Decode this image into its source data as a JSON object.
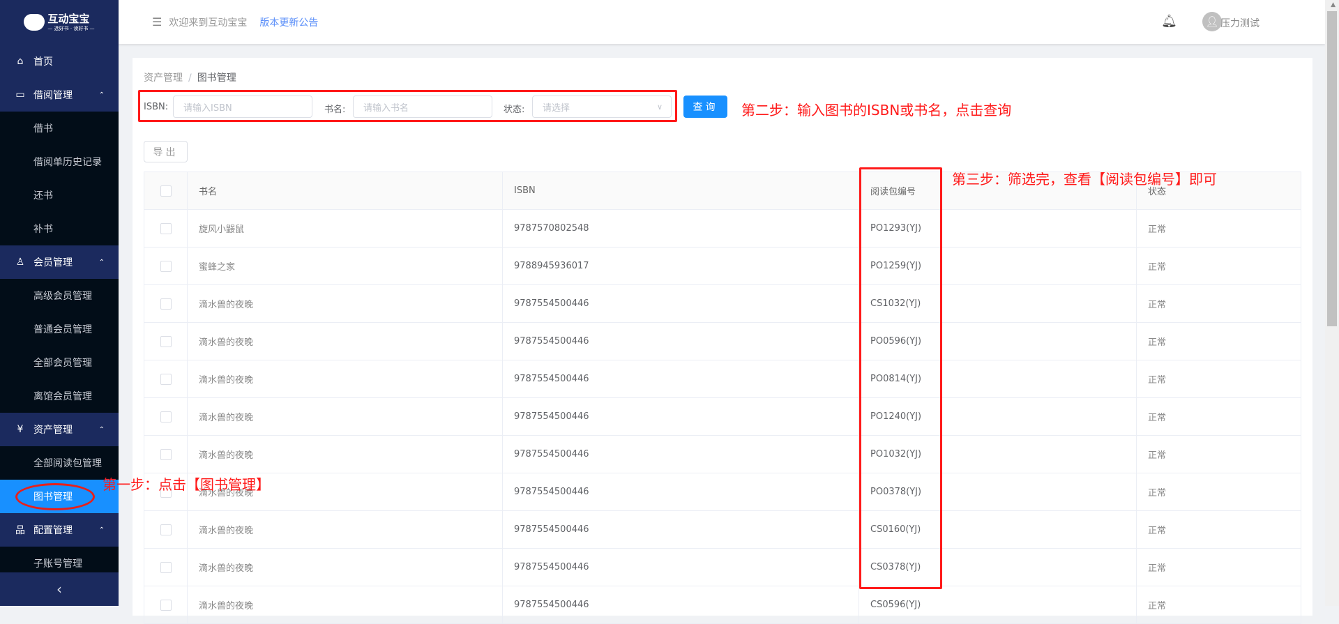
{
  "sidebar": {
    "logo": {
      "title": "互动宝宝",
      "subtitle": "— 选好书 · 读好书 —"
    },
    "items": [
      {
        "label": "首页",
        "type": "top",
        "icon": "home-icon"
      },
      {
        "label": "借阅管理",
        "type": "top",
        "icon": "book-icon",
        "expanded": true
      },
      {
        "label": "借书",
        "type": "sub"
      },
      {
        "label": "借阅单历史记录",
        "type": "sub"
      },
      {
        "label": "还书",
        "type": "sub"
      },
      {
        "label": "补书",
        "type": "sub"
      },
      {
        "label": "会员管理",
        "type": "top",
        "icon": "members-icon",
        "expanded": true
      },
      {
        "label": "高级会员管理",
        "type": "sub"
      },
      {
        "label": "普通会员管理",
        "type": "sub"
      },
      {
        "label": "全部会员管理",
        "type": "sub"
      },
      {
        "label": "离馆会员管理",
        "type": "sub"
      },
      {
        "label": "资产管理",
        "type": "top",
        "icon": "asset-icon",
        "expanded": true
      },
      {
        "label": "全部阅读包管理",
        "type": "sub"
      },
      {
        "label": "图书管理",
        "type": "sub",
        "active": true
      },
      {
        "label": "配置管理",
        "type": "top",
        "icon": "sitemap-icon",
        "expanded": true
      },
      {
        "label": "子账号管理",
        "type": "sub"
      }
    ],
    "collapse_icon": "‹"
  },
  "header": {
    "welcome": "欢迎来到互动宝宝",
    "notice_link": "版本更新公告",
    "username": "压力测试"
  },
  "breadcrumb": {
    "parent": "资产管理",
    "current": "图书管理"
  },
  "filters": {
    "isbn_label": "ISBN:",
    "isbn_placeholder": "请输入ISBN",
    "name_label": "书名:",
    "name_placeholder": "请输入书名",
    "status_label": "状态:",
    "status_placeholder": "请选择",
    "query_button": "查询"
  },
  "export_button": "导出",
  "table": {
    "columns": [
      "书名",
      "ISBN",
      "阅读包编号",
      "状态"
    ],
    "rows": [
      [
        "旋风小鼹鼠",
        "9787570802548",
        "PO1293(YJ)",
        "正常"
      ],
      [
        "蜜蜂之家",
        "9788945936017",
        "PO1259(YJ)",
        "正常"
      ],
      [
        "滴水兽的夜晚",
        "9787554500446",
        "CS1032(YJ)",
        "正常"
      ],
      [
        "滴水兽的夜晚",
        "9787554500446",
        "PO0596(YJ)",
        "正常"
      ],
      [
        "滴水兽的夜晚",
        "9787554500446",
        "PO0814(YJ)",
        "正常"
      ],
      [
        "滴水兽的夜晚",
        "9787554500446",
        "PO1240(YJ)",
        "正常"
      ],
      [
        "滴水兽的夜晚",
        "9787554500446",
        "PO1032(YJ)",
        "正常"
      ],
      [
        "滴水兽的夜晚",
        "9787554500446",
        "PO0378(YJ)",
        "正常"
      ],
      [
        "滴水兽的夜晚",
        "9787554500446",
        "CS0160(YJ)",
        "正常"
      ],
      [
        "滴水兽的夜晚",
        "9787554500446",
        "CS0378(YJ)",
        "正常"
      ],
      [
        "滴水兽的夜晚",
        "9787554500446",
        "CS0596(YJ)",
        "正常"
      ]
    ]
  },
  "annotations": {
    "step1": "第一步：点击【图书管理】",
    "step2": "第二步：输入图书的ISBN或书名，点击查询",
    "step3": "第三步：筛选完，查看【阅读包编号】即可"
  },
  "colors": {
    "sidebar": "#1b2a5e",
    "submenu": "#020d18",
    "accent": "#1890ff",
    "annotation": "#ff1a1a"
  }
}
